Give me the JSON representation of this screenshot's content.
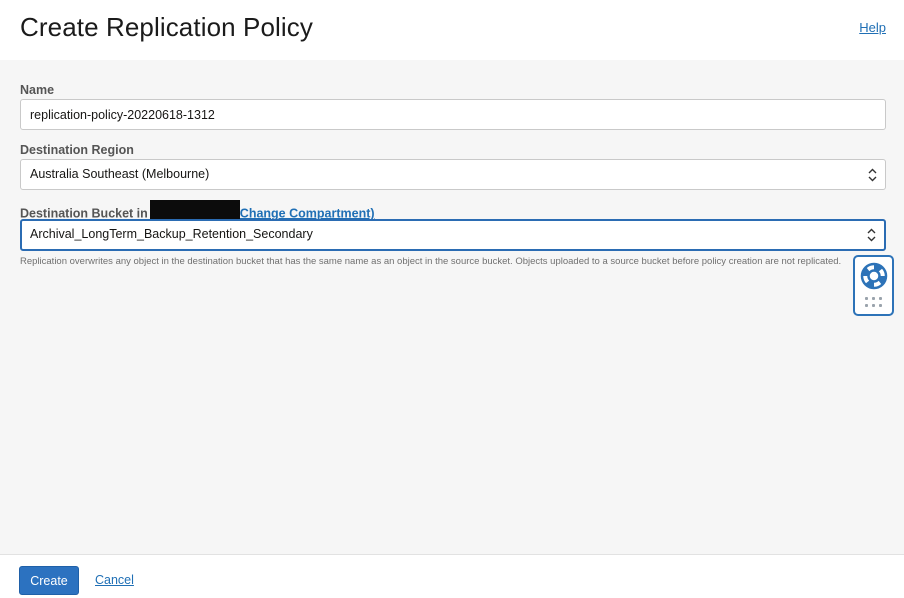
{
  "header": {
    "title": "Create Replication Policy",
    "help_label": "Help"
  },
  "form": {
    "name": {
      "label": "Name",
      "value": "replication-policy-20220618-1312"
    },
    "destination_region": {
      "label": "Destination Region",
      "value": "Australia Southeast (Melbourne)"
    },
    "destination_bucket": {
      "label_prefix": "Destination Bucket in",
      "change_compartment_label": "Change Compartment)",
      "value": "Archival_LongTerm_Backup_Retention_Secondary",
      "helper_text": "Replication overwrites any object in the destination bucket that has the same name as an object in the source bucket. Objects uploaded to a source bucket before policy creation are not replicated."
    }
  },
  "footer": {
    "create_label": "Create",
    "cancel_label": "Cancel"
  },
  "icons": {
    "select_chevron": "chevron-up-down-icon",
    "assist": "lifebuoy-icon",
    "assist_grip": "grip-dots-icon"
  },
  "colors": {
    "accent": "#2c72c0",
    "link": "#1f6fb5",
    "focus_border": "#2b6cb3",
    "background": "#f6f6f6"
  }
}
